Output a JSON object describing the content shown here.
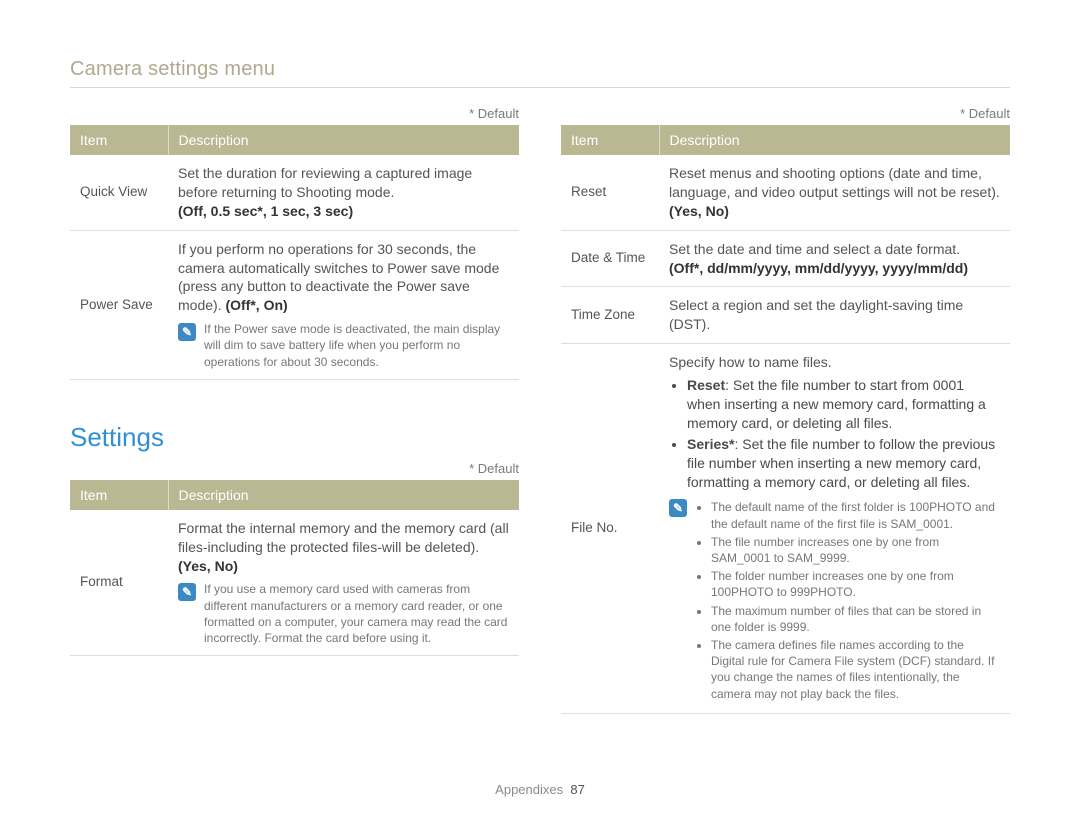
{
  "header": {
    "title": "Camera settings menu"
  },
  "defaultNote": "* Default",
  "tableHeaders": {
    "item": "Item",
    "description": "Description"
  },
  "col1": {
    "table1": {
      "rows": [
        {
          "item": "Quick View",
          "text": "Set the duration for reviewing a captured image before returning to Shooting mode.",
          "options": "(Off, 0.5 sec*, 1 sec, 3 sec)"
        },
        {
          "item": "Power Save",
          "text_part1": "If you perform no operations for 30 seconds, the camera automatically switches to Power save mode (press any button to deactivate the Power save mode). ",
          "options_inline": "(Off*, On)",
          "note": "If the Power save mode is deactivated, the main display will dim to save battery life when you perform no operations for about 30 seconds."
        }
      ]
    },
    "sectionHeading": "Settings",
    "table2": {
      "rows": [
        {
          "item": "Format",
          "text": "Format the internal memory and the memory card (all files-including the protected files-will be deleted).",
          "options": "(Yes, No)",
          "note": "If you use a memory card used with cameras from different manufacturers or a memory card reader, or one formatted on a computer, your camera may read the card incorrectly. Format the card before using it."
        }
      ]
    }
  },
  "col2": {
    "table": {
      "rows": [
        {
          "item": "Reset",
          "text": "Reset menus and shooting options (date and time, language, and video output settings will not be reset).",
          "options": "(Yes, No)"
        },
        {
          "item": "Date & Time",
          "text": "Set the date and time and select a date format.",
          "options": "(Off*, dd/mm/yyyy, mm/dd/yyyy, yyyy/mm/dd)"
        },
        {
          "item": "Time Zone",
          "text": "Select a region and set the daylight-saving time (DST)."
        },
        {
          "item": "File No.",
          "intro": "Specify how to name files.",
          "bullets": [
            {
              "label": "Reset",
              "text": ": Set the file number to start from 0001 when inserting a new memory card, formatting a memory card, or deleting all files."
            },
            {
              "label": "Series*",
              "text": ": Set the file number to follow the previous file number when inserting a new memory card, formatting a memory card, or deleting all files."
            }
          ],
          "noteBullets": [
            "The default name of the first folder is 100PHOTO and the default name of the first file is SAM_0001.",
            "The file number increases one by one from SAM_0001 to SAM_9999.",
            "The folder number increases one by one from 100PHOTO to 999PHOTO.",
            "The maximum number of files that can be stored in one folder is 9999.",
            "The camera defines file names according to the Digital rule for Camera File system (DCF) standard. If you change the names of files intentionally, the camera may not play back the files."
          ]
        }
      ]
    }
  },
  "footer": {
    "section": "Appendixes",
    "page": "87"
  },
  "noteGlyph": "✎"
}
